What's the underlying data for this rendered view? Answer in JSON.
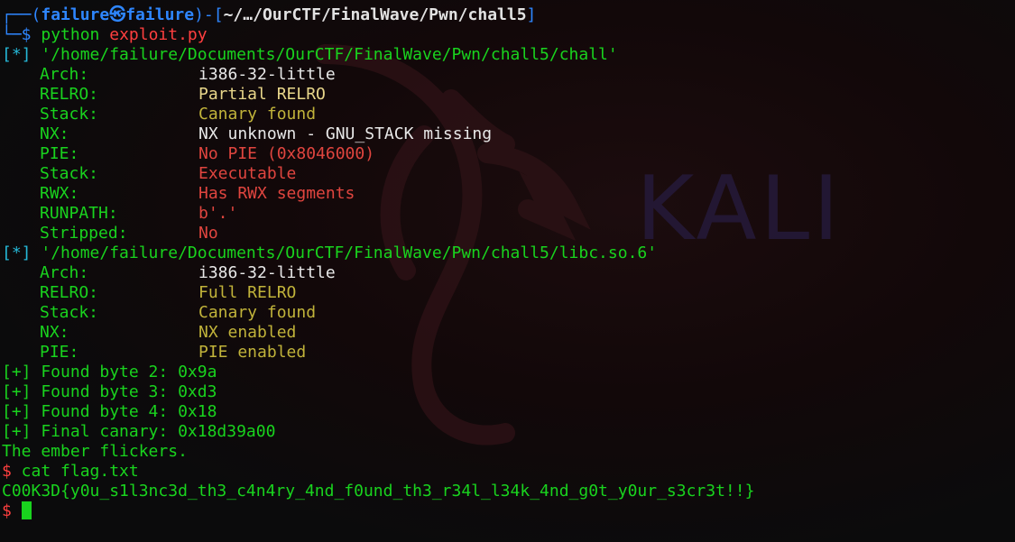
{
  "prompt": {
    "frame_top": "┌──(",
    "user": "failure㉿failure",
    "frame_mid": ")-[",
    "dir": "~/…/OurCTF/FinalWave/Pwn/chall5",
    "frame_end": "]",
    "frame_bottom": "└─$ ",
    "command": "python",
    "argument": "exploit.py"
  },
  "binary1": {
    "marker": "[*]",
    "path": " '/home/failure/Documents/OurCTF/FinalWave/Pwn/chall5/chall'",
    "rows": [
      {
        "key": "Arch:",
        "value": "i386-32-little"
      },
      {
        "key": "RELRO:",
        "value": "Partial RELRO"
      },
      {
        "key": "Stack:",
        "value": "Canary found"
      },
      {
        "key": "NX:",
        "value": "NX unknown - GNU_STACK missing"
      },
      {
        "key": "PIE:",
        "value": "No PIE (0x8046000)"
      },
      {
        "key": "Stack:",
        "value": "Executable"
      },
      {
        "key": "RWX:",
        "value": "Has RWX segments"
      },
      {
        "key": "RUNPATH:",
        "value": "b'.'"
      },
      {
        "key": "Stripped:",
        "value": "No"
      }
    ]
  },
  "binary2": {
    "marker": "[*]",
    "path": " '/home/failure/Documents/OurCTF/FinalWave/Pwn/chall5/libc.so.6'",
    "rows": [
      {
        "key": "Arch:",
        "value": "i386-32-little"
      },
      {
        "key": "RELRO:",
        "value": "Full RELRO"
      },
      {
        "key": "Stack:",
        "value": "Canary found"
      },
      {
        "key": "NX:",
        "value": "NX enabled"
      },
      {
        "key": "PIE:",
        "value": "PIE enabled"
      }
    ]
  },
  "output": [
    "[+] Found byte 2: 0x9a",
    "[+] Found byte 3: 0xd3",
    "[+] Found byte 4: 0x18",
    "[+] Final canary: 0x18d39a00",
    "The ember flickers."
  ],
  "shell": {
    "prompt": "$",
    "cat_command": " cat flag.txt",
    "flag": "C00K3D{y0u_s1l3nc3d_th3_c4n4ry_4nd_f0und_th3_r34l_l34k_4nd_g0t_y0ur_s3cr3t!!}"
  },
  "wallpaper": {
    "logo_text": "KALI"
  },
  "colors": {
    "background": "#0b0b0c",
    "prompt_blue": "#2e86ff",
    "green": "#19d31e",
    "red": "#e0453f",
    "olive": "#c1b33a",
    "cyan": "#25b8d8"
  }
}
